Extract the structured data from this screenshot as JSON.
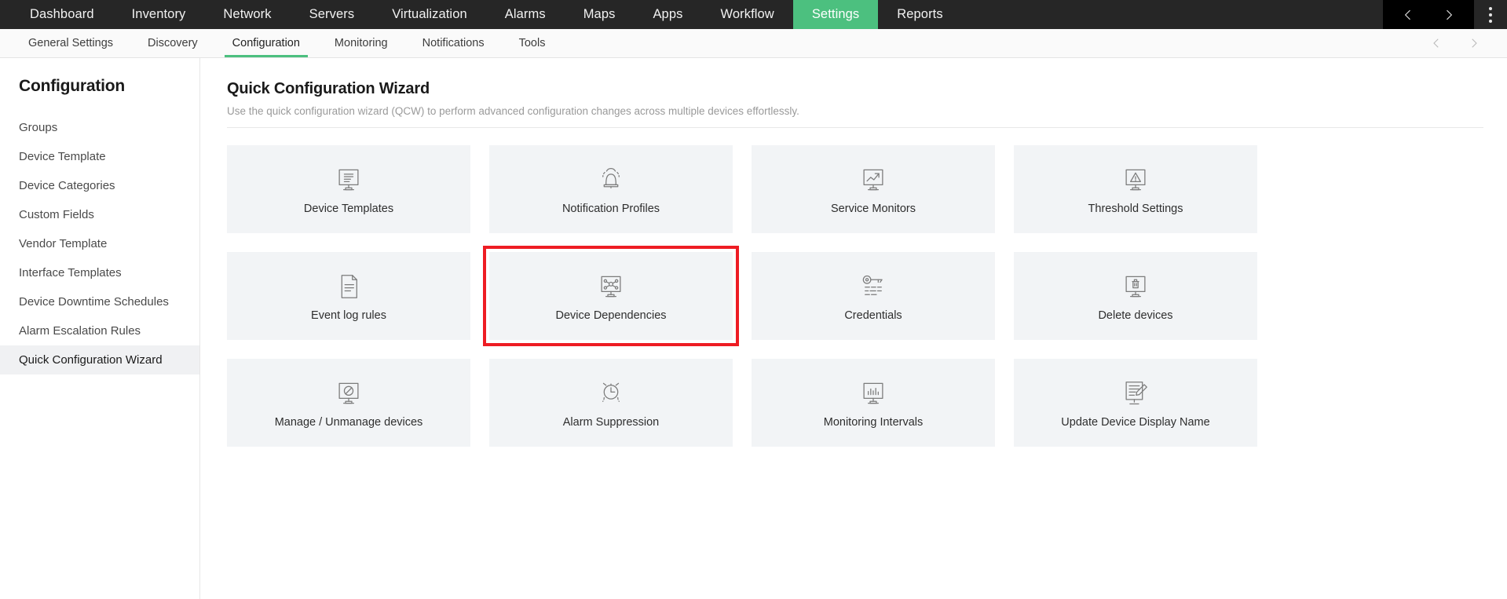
{
  "topnav": {
    "items": [
      {
        "label": "Dashboard",
        "active": false
      },
      {
        "label": "Inventory",
        "active": false
      },
      {
        "label": "Network",
        "active": false
      },
      {
        "label": "Servers",
        "active": false
      },
      {
        "label": "Virtualization",
        "active": false
      },
      {
        "label": "Alarms",
        "active": false
      },
      {
        "label": "Maps",
        "active": false
      },
      {
        "label": "Apps",
        "active": false
      },
      {
        "label": "Workflow",
        "active": false
      },
      {
        "label": "Settings",
        "active": true
      },
      {
        "label": "Reports",
        "active": false
      }
    ],
    "prev_icon": "chevron-left-icon",
    "next_icon": "chevron-right-icon",
    "menu_icon": "kebab-menu-icon",
    "active_color": "#4cc07f",
    "background": "#262626"
  },
  "subnav": {
    "items": [
      {
        "label": "General Settings",
        "active": false
      },
      {
        "label": "Discovery",
        "active": false
      },
      {
        "label": "Configuration",
        "active": true
      },
      {
        "label": "Monitoring",
        "active": false
      },
      {
        "label": "Notifications",
        "active": false
      },
      {
        "label": "Tools",
        "active": false
      }
    ],
    "prev_icon": "chevron-left-icon",
    "next_icon": "chevron-right-icon",
    "accent_color": "#4cc07f"
  },
  "sidebar": {
    "title": "Configuration",
    "items": [
      {
        "label": "Groups",
        "active": false
      },
      {
        "label": "Device Template",
        "active": false
      },
      {
        "label": "Device Categories",
        "active": false
      },
      {
        "label": "Custom Fields",
        "active": false
      },
      {
        "label": "Vendor Template",
        "active": false
      },
      {
        "label": "Interface Templates",
        "active": false
      },
      {
        "label": "Device Downtime Schedules",
        "active": false
      },
      {
        "label": "Alarm Escalation Rules",
        "active": false
      },
      {
        "label": "Quick Configuration Wizard",
        "active": true
      }
    ]
  },
  "main": {
    "title": "Quick Configuration Wizard",
    "subtitle": "Use the quick configuration wizard (QCW) to perform advanced configuration changes across multiple devices effortlessly.",
    "highlight_color": "#ee1c23",
    "cards": [
      {
        "label": "Device Templates",
        "icon": "monitor-document-icon",
        "highlighted": false
      },
      {
        "label": "Notification Profiles",
        "icon": "bell-ringing-icon",
        "highlighted": false
      },
      {
        "label": "Service Monitors",
        "icon": "monitor-trend-up-icon",
        "highlighted": false
      },
      {
        "label": "Threshold Settings",
        "icon": "monitor-warning-icon",
        "highlighted": false
      },
      {
        "label": "Event log rules",
        "icon": "document-lines-icon",
        "highlighted": false
      },
      {
        "label": "Device Dependencies",
        "icon": "monitor-network-nodes-icon",
        "highlighted": true
      },
      {
        "label": "Credentials",
        "icon": "key-keyboard-icon",
        "highlighted": false
      },
      {
        "label": "Delete devices",
        "icon": "monitor-trash-icon",
        "highlighted": false
      },
      {
        "label": "Manage / Unmanage devices",
        "icon": "monitor-prohibited-icon",
        "highlighted": false
      },
      {
        "label": "Alarm Suppression",
        "icon": "alarm-clock-icon",
        "highlighted": false
      },
      {
        "label": "Monitoring Intervals",
        "icon": "monitor-bar-chart-icon",
        "highlighted": false
      },
      {
        "label": "Update Device Display Name",
        "icon": "monitor-pencil-icon",
        "highlighted": false
      }
    ]
  }
}
